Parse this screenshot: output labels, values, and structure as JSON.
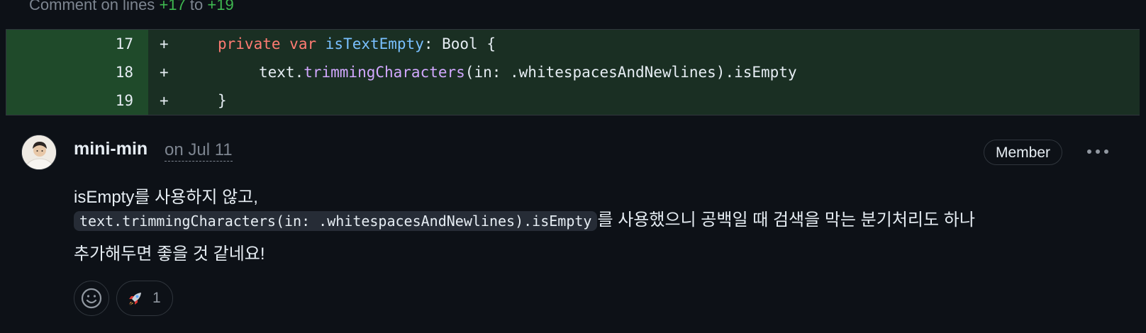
{
  "comment_header": {
    "prefix": "Comment on lines",
    "start": "+17",
    "joiner": "to",
    "end": "+19"
  },
  "diff": {
    "lines": [
      {
        "number": "17",
        "sign": "+",
        "kw1": "private",
        "kw2": "var",
        "name": "isTextEmpty",
        "rest": ": Bool {"
      },
      {
        "number": "18",
        "sign": "+",
        "pre": "text.",
        "fn": "trimmingCharacters",
        "rest": "(in: .whitespacesAndNewlines).isEmpty"
      },
      {
        "number": "19",
        "sign": "+",
        "text": "}"
      }
    ]
  },
  "comment": {
    "author": "mini-min",
    "date": "on Jul 11",
    "role": "Member",
    "body_line1": "isEmpty를 사용하지 않고,",
    "inline_code": "text.trimmingCharacters(in: .whitespacesAndNewlines).isEmpty",
    "body_line2_rest": "를 사용했으니 공백일 때 검색을 막는 분기처리도 하나",
    "body_line3": "추가해두면 좋을 것 같네요!",
    "reactions": [
      {
        "icon": "rocket-icon",
        "count": "1"
      }
    ],
    "add_reaction_icon": "smiley-icon",
    "more_icon": "kebab-horizontal-icon"
  },
  "colors": {
    "background": "#0d1117",
    "added_line_number_bg": "#1f4a2a",
    "added_line_bg": "#1a2f23",
    "keyword": "#ff7b72",
    "identifier": "#79c0ff",
    "function": "#d2a8ff",
    "muted": "#7d8590",
    "green": "#3fb950"
  }
}
